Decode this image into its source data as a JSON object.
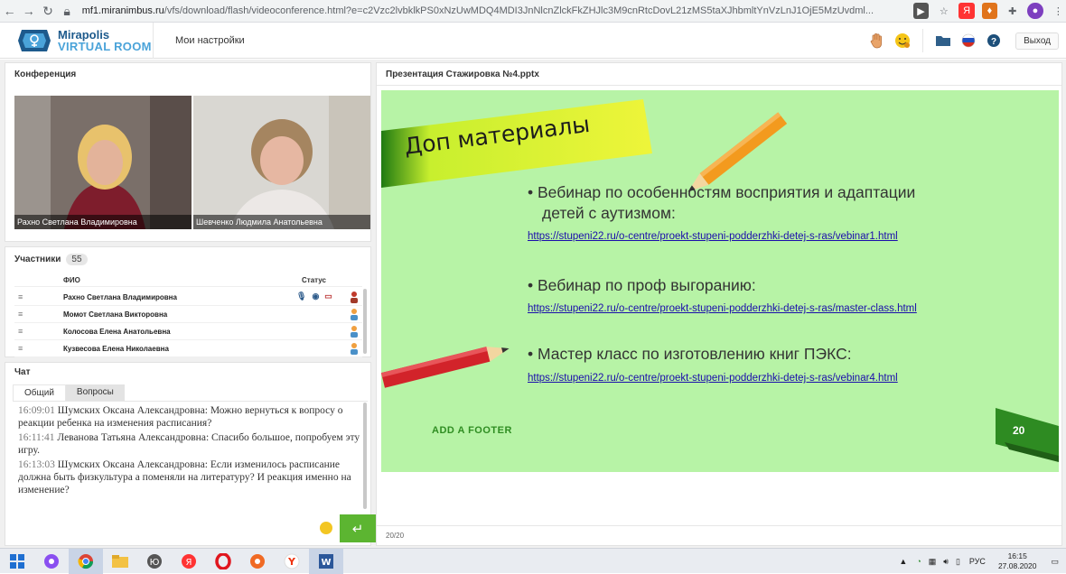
{
  "browser": {
    "url_domain": "mf1.miranimbus.ru",
    "url_rest": "/vfs/download/flash/videoconference.html?e=c2Vzc2lvbklkPS0xNzUwMDQ4MDI3JnNlcnZlckFkZHJlc3M9cnRtcDovL21zMS5taXJhbmltYnVzLnJ1OjE5MzUvdml..."
  },
  "app": {
    "logo_line1": "Mirapolis",
    "logo_line2": "VIRTUAL ROOM",
    "my_settings": "Мои настройки",
    "exit_label": "Выход"
  },
  "conference": {
    "title": "Конференция",
    "videos": [
      {
        "name": "Рахно Светлана Владимировна"
      },
      {
        "name": "Шевченко  Людмила  Анатольевна"
      }
    ]
  },
  "participants": {
    "title": "Участники",
    "count": "55",
    "col_name": "ФИО",
    "col_status": "Статус",
    "rows": [
      {
        "name": "Рахно Светлана Владимировна"
      },
      {
        "name": "Момот Светлана   Викторовна"
      },
      {
        "name": "Колосова Елена  Анатольевна"
      },
      {
        "name": "Кузвесова Елена  Николаевна"
      }
    ]
  },
  "chat": {
    "title": "Чат",
    "tab_general": "Общий",
    "tab_questions": "Вопросы",
    "messages": [
      {
        "time": "16:09:01",
        "text": " Шумских Оксана  Александровна: Можно вернуться к вопросу о реакции ребенка на изменения расписания?"
      },
      {
        "time": "16:11:41",
        "text": " Леванова Татьяна  Александровна: Спасибо большое, попробуем эту игру."
      },
      {
        "time": "16:13:03",
        "text": " Шумских Оксана  Александровна: Если изменилось расписание должна быть физкультура а поменяли на литературу? И реакция именно на изменение?"
      }
    ],
    "send_icon": "enter-arrow-icon"
  },
  "presentation": {
    "title": "Презентация Стажировка №4.pptx",
    "slide_title": "Доп материалы",
    "bullets": [
      {
        "text_line1": "• Вебинар по особенностям восприятия и адаптации",
        "text_line2": "детей с аутизмом:",
        "link": "https://stupeni22.ru/o-centre/proekt-stupeni-podderzhki-detej-s-ras/vebinar1.html"
      },
      {
        "text_line1": "• Вебинар по проф выгоранию:",
        "text_line2": "",
        "link": "https://stupeni22.ru/o-centre/proekt-stupeni-podderzhki-detej-s-ras/master-class.html"
      },
      {
        "text_line1": "• Мастер класс по изготовлению книг ПЭКС:",
        "text_line2": "",
        "link": "https://stupeni22.ru/o-centre/proekt-stupeni-podderzhki-detej-s-ras/vebinar4.html"
      }
    ],
    "footer_text": "ADD A FOOTER",
    "slide_number": "20",
    "page_counter": "20/20",
    "colors": {
      "slide_bg": "#b7f3a6",
      "title_band": "#d8f53a",
      "corner_green": "#2e8b22"
    }
  },
  "taskbar": {
    "lang": "РУС",
    "time": "16:15",
    "date": "27.08.2020"
  }
}
